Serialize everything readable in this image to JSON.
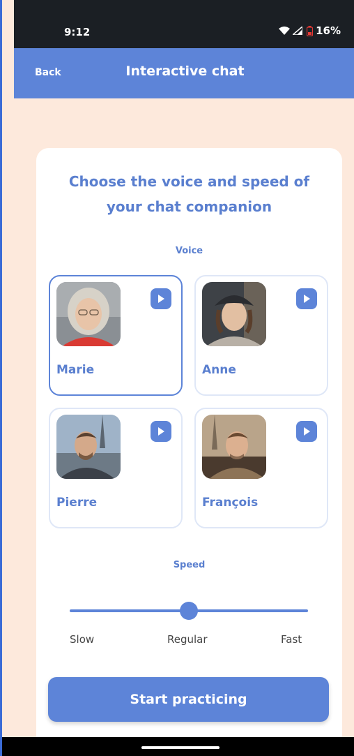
{
  "status_bar": {
    "time": "9:12",
    "battery": "16%"
  },
  "header": {
    "back_label": "Back",
    "title": "Interactive chat"
  },
  "card": {
    "title": "Choose the voice and speed of your chat companion",
    "voice_label": "Voice",
    "speed_label": "Speed"
  },
  "voices": [
    {
      "name": "Marie",
      "selected": true
    },
    {
      "name": "Anne",
      "selected": false
    },
    {
      "name": "Pierre",
      "selected": false
    },
    {
      "name": "François",
      "selected": false
    }
  ],
  "speed": {
    "options": [
      "Slow",
      "Regular",
      "Fast"
    ],
    "selected": "Regular",
    "value_fraction": 0.5
  },
  "start_button": {
    "label": "Start practicing"
  },
  "colors": {
    "accent": "#5d84d8",
    "background": "#fde9dc",
    "card": "#ffffff",
    "status_bar": "#1b1f24",
    "battery_low": "#e53935"
  }
}
